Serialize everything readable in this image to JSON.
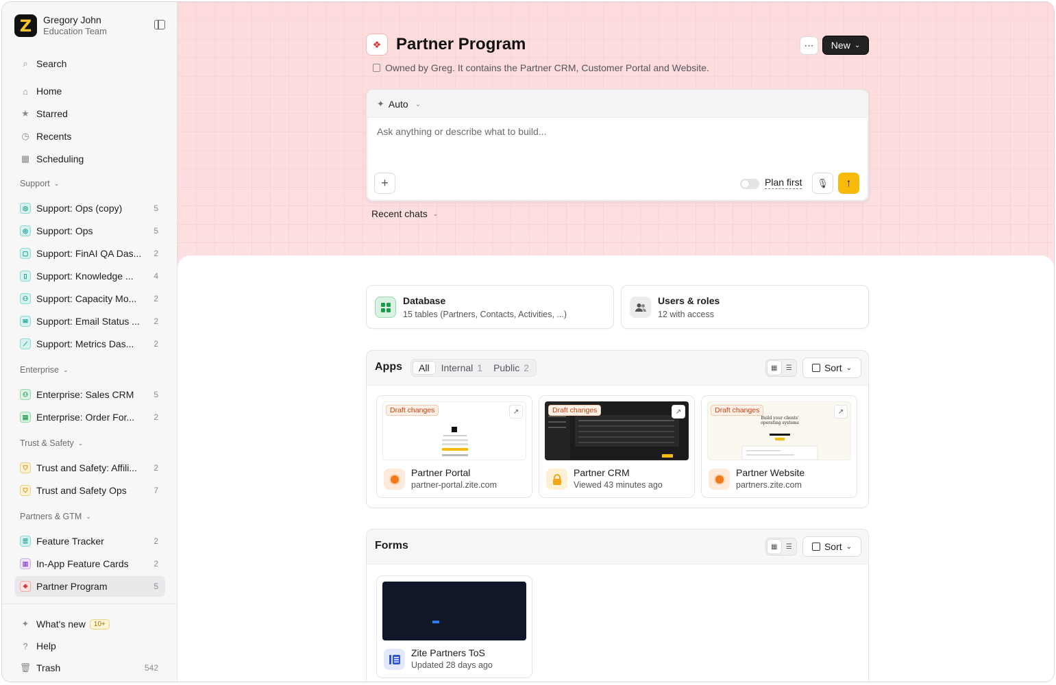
{
  "workspace": {
    "name": "Gregory John",
    "team": "Education Team",
    "logo_letter": "Z"
  },
  "nav": {
    "search": "Search",
    "items": [
      {
        "label": "Home",
        "icon": "home-icon"
      },
      {
        "label": "Starred",
        "icon": "star-icon"
      },
      {
        "label": "Recents",
        "icon": "clock-icon"
      },
      {
        "label": "Scheduling",
        "icon": "calendar-icon"
      }
    ]
  },
  "groups": [
    {
      "title": "Support",
      "items": [
        {
          "label": "Support: Ops (copy)",
          "count": "5",
          "color": "teal"
        },
        {
          "label": "Support: Ops",
          "count": "5",
          "color": "teal"
        },
        {
          "label": "Support: FinAI QA Das...",
          "count": "2",
          "color": "teal"
        },
        {
          "label": "Support: Knowledge ...",
          "count": "4",
          "color": "teal"
        },
        {
          "label": "Support: Capacity Mo...",
          "count": "2",
          "color": "teal"
        },
        {
          "label": "Support: Email Status ...",
          "count": "2",
          "color": "teal"
        },
        {
          "label": "Support: Metrics Das...",
          "count": "2",
          "color": "teal"
        }
      ]
    },
    {
      "title": "Enterprise",
      "items": [
        {
          "label": "Enterprise: Sales CRM",
          "count": "5",
          "color": "green"
        },
        {
          "label": "Enterprise: Order For...",
          "count": "2",
          "color": "green"
        }
      ]
    },
    {
      "title": "Trust & Safety",
      "items": [
        {
          "label": "Trust and Safety: Affili...",
          "count": "2",
          "color": "amber"
        },
        {
          "label": "Trust and Safety Ops",
          "count": "7",
          "color": "amber"
        }
      ]
    },
    {
      "title": "Partners & GTM",
      "items": [
        {
          "label": "Feature Tracker",
          "count": "2",
          "color": "teal"
        },
        {
          "label": "In-App Feature Cards",
          "count": "2",
          "color": "purple"
        },
        {
          "label": "Partner Program",
          "count": "5",
          "color": "red"
        }
      ]
    }
  ],
  "bottom": {
    "whats_new": "What's new",
    "whats_new_badge": "10+",
    "help": "Help",
    "trash": "Trash",
    "trash_count": "542"
  },
  "page": {
    "title": "Partner Program",
    "subtitle": "Owned by Greg. It contains the Partner CRM, Customer Portal and Website.",
    "more": "⋯",
    "new_button": "New"
  },
  "composer": {
    "mode": "Auto",
    "placeholder": "Ask anything or describe what to build...",
    "plan_first": "Plan first"
  },
  "recent_chats": "Recent chats",
  "categories": [
    {
      "title": "Database",
      "sub": "15 tables (Partners, Contacts, Activities, ...)"
    },
    {
      "title": "Users & roles",
      "sub": "12 with access"
    }
  ],
  "apps": {
    "title": "Apps",
    "tabs": [
      {
        "label": "All",
        "count": ""
      },
      {
        "label": "Internal",
        "count": "1"
      },
      {
        "label": "Public",
        "count": "2"
      }
    ],
    "sort": "Sort",
    "draft_label": "Draft changes",
    "items": [
      {
        "name": "Partner Portal",
        "sub": "partner-portal.zite.com"
      },
      {
        "name": "Partner CRM",
        "sub": "Viewed 43 minutes ago"
      },
      {
        "name": "Partner Website",
        "sub": "partners.zite.com",
        "thumb_heading": "Build your clients' operating systems"
      }
    ]
  },
  "forms": {
    "title": "Forms",
    "sort": "Sort",
    "items": [
      {
        "name": "Zite Partners ToS",
        "sub": "Updated 28 days ago"
      }
    ]
  }
}
